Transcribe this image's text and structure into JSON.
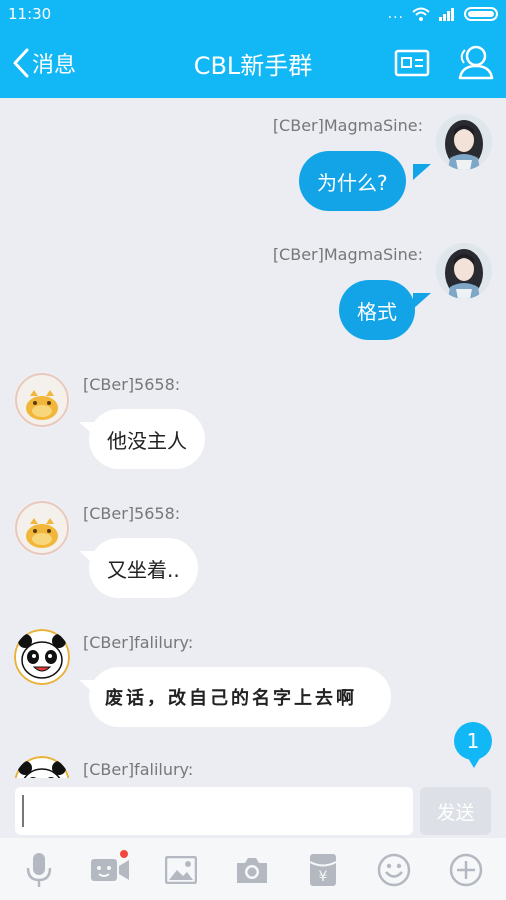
{
  "status": {
    "time": "11:30",
    "dots": "..."
  },
  "header": {
    "back_label": "消息",
    "title": "CBL新手群"
  },
  "messages": [
    {
      "sender": "[CBer]MagmaSine:",
      "text": "为什么?",
      "side": "out"
    },
    {
      "sender": "[CBer]MagmaSine:",
      "text": "格式",
      "side": "out"
    },
    {
      "sender": "[CBer]5658:",
      "text": "他没主人",
      "side": "in"
    },
    {
      "sender": "[CBer]5658:",
      "text": "又坐着..",
      "side": "in"
    },
    {
      "sender": "[CBer]falilury:",
      "text": "废话，改自己的名字上去啊",
      "side": "in"
    },
    {
      "sender": "[CBer]falilury:",
      "text": "",
      "side": "in"
    }
  ],
  "unread_count": "1",
  "input": {
    "value": "",
    "send_label": "发送"
  },
  "toolbar": {
    "icons": [
      "mic-icon",
      "video-icon",
      "image-icon",
      "camera-icon",
      "red-packet-icon",
      "emoji-icon",
      "plus-icon"
    ]
  },
  "colors": {
    "accent": "#12b7f5",
    "bubble_out": "#13a4e8",
    "background": "#ebedf3",
    "notification_dot": "#f2473f"
  }
}
